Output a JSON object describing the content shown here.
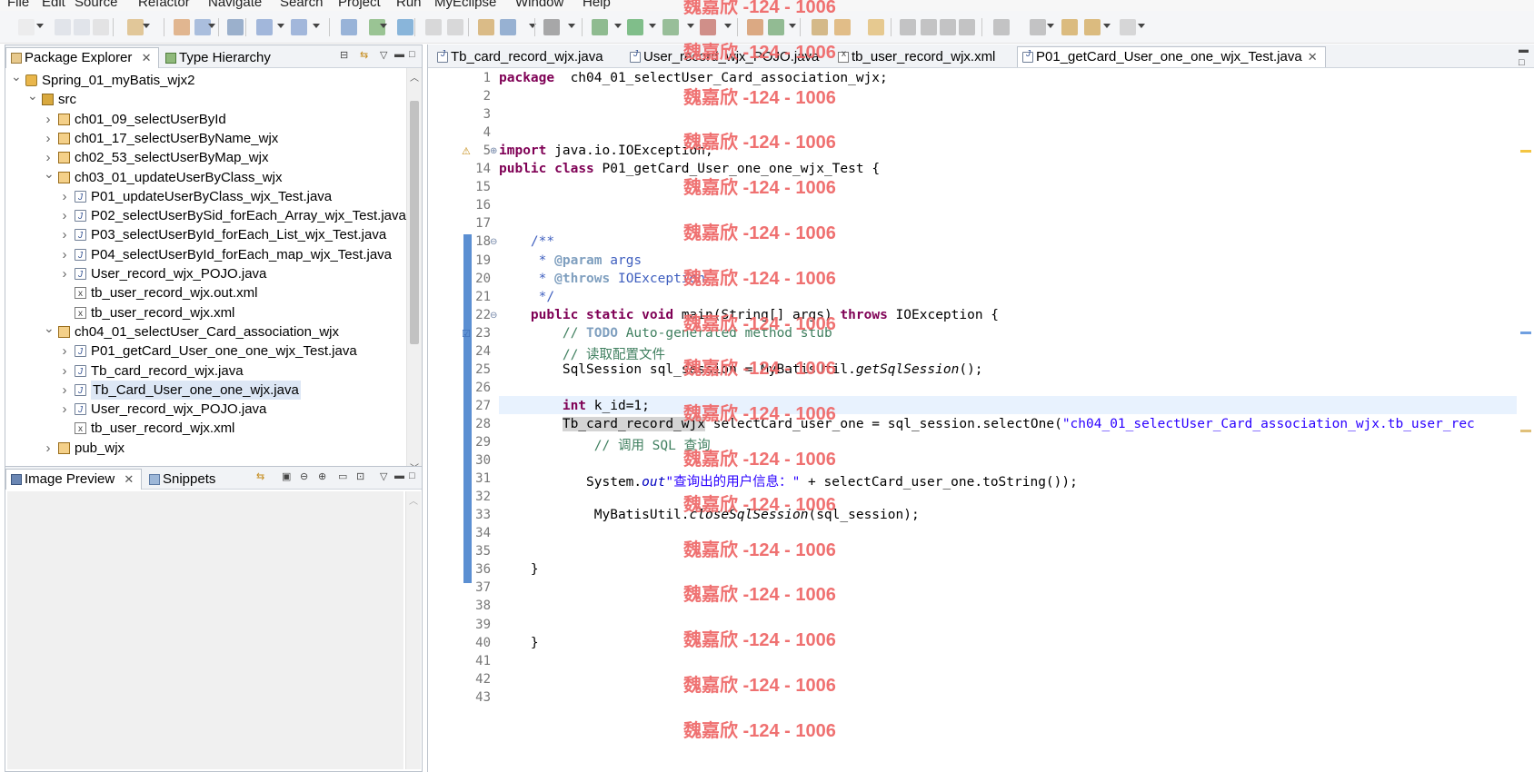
{
  "menubar": {
    "items": [
      "File",
      "Edit",
      "Source",
      "Refactor",
      "Navigate",
      "Search",
      "Project",
      "Run",
      "MyEclipse",
      "Window",
      "Help"
    ]
  },
  "left_top_panel": {
    "tabs": [
      {
        "label": "Package Explorer",
        "closable": true,
        "active": true
      },
      {
        "label": "Type Hierarchy",
        "closable": false,
        "active": false
      }
    ],
    "tree": [
      {
        "label": "Spring_01_myBatis_wjx2",
        "icon": "project-icon",
        "depth": 0,
        "expanded": true
      },
      {
        "label": "src",
        "icon": "source-folder-icon",
        "depth": 1,
        "expanded": true
      },
      {
        "label": "ch01_09_selectUserById",
        "icon": "package-icon",
        "depth": 2,
        "expanded": false
      },
      {
        "label": "ch01_17_selectUserByName_wjx",
        "icon": "package-icon",
        "depth": 2,
        "expanded": false
      },
      {
        "label": "ch02_53_selectUserByMap_wjx",
        "icon": "package-icon",
        "depth": 2,
        "expanded": false
      },
      {
        "label": "ch03_01_updateUserByClass_wjx",
        "icon": "package-icon",
        "depth": 2,
        "expanded": true
      },
      {
        "label": "P01_updateUserByClass_wjx_Test.java",
        "icon": "java-file-icon",
        "depth": 3,
        "expanded": false
      },
      {
        "label": "P02_selectUserBySid_forEach_Array_wjx_Test.java",
        "icon": "java-file-icon",
        "depth": 3,
        "expanded": false
      },
      {
        "label": "P03_selectUserById_forEach_List_wjx_Test.java",
        "icon": "java-file-icon",
        "depth": 3,
        "expanded": false
      },
      {
        "label": "P04_selectUserById_forEach_map_wjx_Test.java",
        "icon": "java-file-icon",
        "depth": 3,
        "expanded": false
      },
      {
        "label": "User_record_wjx_POJO.java",
        "icon": "java-file-icon",
        "depth": 3,
        "expanded": false
      },
      {
        "label": "tb_user_record_wjx.out.xml",
        "icon": "xml-file-icon",
        "depth": 3,
        "leaf": true
      },
      {
        "label": "tb_user_record_wjx.xml",
        "icon": "xml-file-icon",
        "depth": 3,
        "leaf": true
      },
      {
        "label": "ch04_01_selectUser_Card_association_wjx",
        "icon": "package-icon",
        "depth": 2,
        "expanded": true
      },
      {
        "label": "P01_getCard_User_one_one_wjx_Test.java",
        "icon": "java-file-icon",
        "depth": 3,
        "expanded": false
      },
      {
        "label": "Tb_card_record_wjx.java",
        "icon": "java-file-icon",
        "depth": 3,
        "expanded": false
      },
      {
        "label": "Tb_Card_User_one_one_wjx.java",
        "icon": "java-file-icon",
        "depth": 3,
        "expanded": false,
        "selected": true
      },
      {
        "label": "User_record_wjx_POJO.java",
        "icon": "java-file-icon",
        "depth": 3,
        "expanded": false
      },
      {
        "label": "tb_user_record_wjx.xml",
        "icon": "xml-file-icon",
        "depth": 3,
        "leaf": true
      },
      {
        "label": "pub_wjx",
        "icon": "package-icon",
        "depth": 2,
        "expanded": false
      }
    ]
  },
  "left_bottom_panel": {
    "tabs": [
      {
        "label": "Image Preview",
        "closable": true,
        "active": true
      },
      {
        "label": "Snippets",
        "closable": false,
        "active": false
      }
    ]
  },
  "editor": {
    "tabs": [
      {
        "label": "Tb_card_record_wjx.java",
        "icon": "java-file-icon",
        "active": false
      },
      {
        "label": "User_record_wjx_POJO.java",
        "icon": "java-file-icon",
        "active": false
      },
      {
        "label": "tb_user_record_wjx.xml",
        "icon": "xml-file-icon",
        "active": false
      },
      {
        "label": "P01_getCard_User_one_one_wjx_Test.java",
        "icon": "java-file-icon",
        "active": true,
        "closable": true
      }
    ],
    "lines": [
      {
        "n": "1",
        "segs": [
          [
            "kw",
            "package"
          ],
          [
            "",
            "  ch04_01_selectUser_Card_association_wjx;"
          ]
        ]
      },
      {
        "n": "2",
        "segs": []
      },
      {
        "n": "3",
        "segs": []
      },
      {
        "n": "4",
        "segs": []
      },
      {
        "n": "5",
        "segs": [
          [
            "kw",
            "import"
          ],
          [
            "",
            " java.io.IOException;"
          ]
        ],
        "fold": "expand"
      },
      {
        "n": "14",
        "segs": [
          [
            "kw",
            "public"
          ],
          [
            "",
            " "
          ],
          [
            "kw",
            "class"
          ],
          [
            "",
            " P01_getCard_User_one_one_wjx_Test {"
          ]
        ]
      },
      {
        "n": "15",
        "segs": []
      },
      {
        "n": "16",
        "segs": []
      },
      {
        "n": "17",
        "segs": []
      },
      {
        "n": "18",
        "segs": [
          [
            "",
            "    "
          ],
          [
            "jd",
            "/**"
          ]
        ],
        "fold": "collapse"
      },
      {
        "n": "19",
        "segs": [
          [
            "",
            "     "
          ],
          [
            "jd",
            "* "
          ],
          [
            "tag",
            "@param"
          ],
          [
            "jd",
            " args"
          ]
        ]
      },
      {
        "n": "20",
        "segs": [
          [
            "",
            "     "
          ],
          [
            "jd",
            "* "
          ],
          [
            "tag",
            "@throws"
          ],
          [
            "jd",
            " IOException"
          ]
        ]
      },
      {
        "n": "21",
        "segs": [
          [
            "",
            "     "
          ],
          [
            "jd",
            "*/"
          ]
        ]
      },
      {
        "n": "22",
        "segs": [
          [
            "",
            "    "
          ],
          [
            "kw",
            "public"
          ],
          [
            "",
            " "
          ],
          [
            "kw",
            "static"
          ],
          [
            "",
            " "
          ],
          [
            "kw",
            "void"
          ],
          [
            "",
            " main(String[] args) "
          ],
          [
            "kw",
            "throws"
          ],
          [
            "",
            " IOException {"
          ]
        ],
        "fold": "collapse"
      },
      {
        "n": "23",
        "segs": [
          [
            "",
            "        "
          ],
          [
            "cm",
            "// "
          ],
          [
            "todo",
            "TODO"
          ],
          [
            "cm",
            " Auto-generated method stub"
          ]
        ]
      },
      {
        "n": "24",
        "segs": [
          [
            "",
            "        "
          ],
          [
            "cm",
            "// 读取配置文件"
          ]
        ]
      },
      {
        "n": "25",
        "segs": [
          [
            "",
            "        SqlSession sql_session = MyBatisUtil."
          ],
          [
            "ital",
            "getSqlSession"
          ],
          [
            "",
            "();"
          ]
        ]
      },
      {
        "n": "26",
        "segs": []
      },
      {
        "n": "27",
        "segs": [
          [
            "",
            "        "
          ],
          [
            "kw",
            "int"
          ],
          [
            "",
            " k_id=1;"
          ]
        ],
        "current": true
      },
      {
        "n": "28",
        "segs": [
          [
            "",
            "        "
          ],
          [
            "hlv",
            "Tb_card_record_wjx"
          ],
          [
            "",
            " selectCard_user_one = sql_session.selectOne("
          ],
          [
            "str",
            "\"ch04_01_selectUser_Card_association_wjx.tb_user_rec"
          ]
        ]
      },
      {
        "n": "29",
        "segs": [
          [
            "",
            "            "
          ],
          [
            "cm",
            "// 调用 SQL 查询"
          ]
        ]
      },
      {
        "n": "30",
        "segs": []
      },
      {
        "n": "31",
        "segs": [
          [
            "",
            "           System."
          ],
          [
            "fld",
            "out"
          ],
          [
            ".println("
          ],
          [
            "str",
            "\"查询出的用户信息：\""
          ],
          [
            "",
            " + selectCard_user_one.toString());"
          ]
        ]
      },
      {
        "n": "32",
        "segs": []
      },
      {
        "n": "33",
        "segs": [
          [
            "",
            "            MyBatisUtil."
          ],
          [
            "ital",
            "closeSqlSession"
          ],
          [
            "",
            "(sql_session);"
          ]
        ]
      },
      {
        "n": "34",
        "segs": []
      },
      {
        "n": "35",
        "segs": []
      },
      {
        "n": "36",
        "segs": [
          [
            "",
            "    }"
          ]
        ]
      },
      {
        "n": "37",
        "segs": []
      },
      {
        "n": "38",
        "segs": []
      },
      {
        "n": "39",
        "segs": []
      },
      {
        "n": "40",
        "segs": [
          [
            "",
            "    }"
          ]
        ]
      },
      {
        "n": "41",
        "segs": []
      },
      {
        "n": "42",
        "segs": []
      },
      {
        "n": "43",
        "segs": []
      }
    ]
  },
  "watermark": {
    "text": "魏嘉欣 -124 - 1006",
    "color": "#ef6a6a",
    "count": 17
  },
  "colors": {
    "keyword": "#7f0055",
    "comment": "#3f7f5f",
    "javadoc": "#3f5fbf",
    "string": "#2a00ff",
    "current_line": "#e8f2fe",
    "selection": "#dde7f5"
  }
}
